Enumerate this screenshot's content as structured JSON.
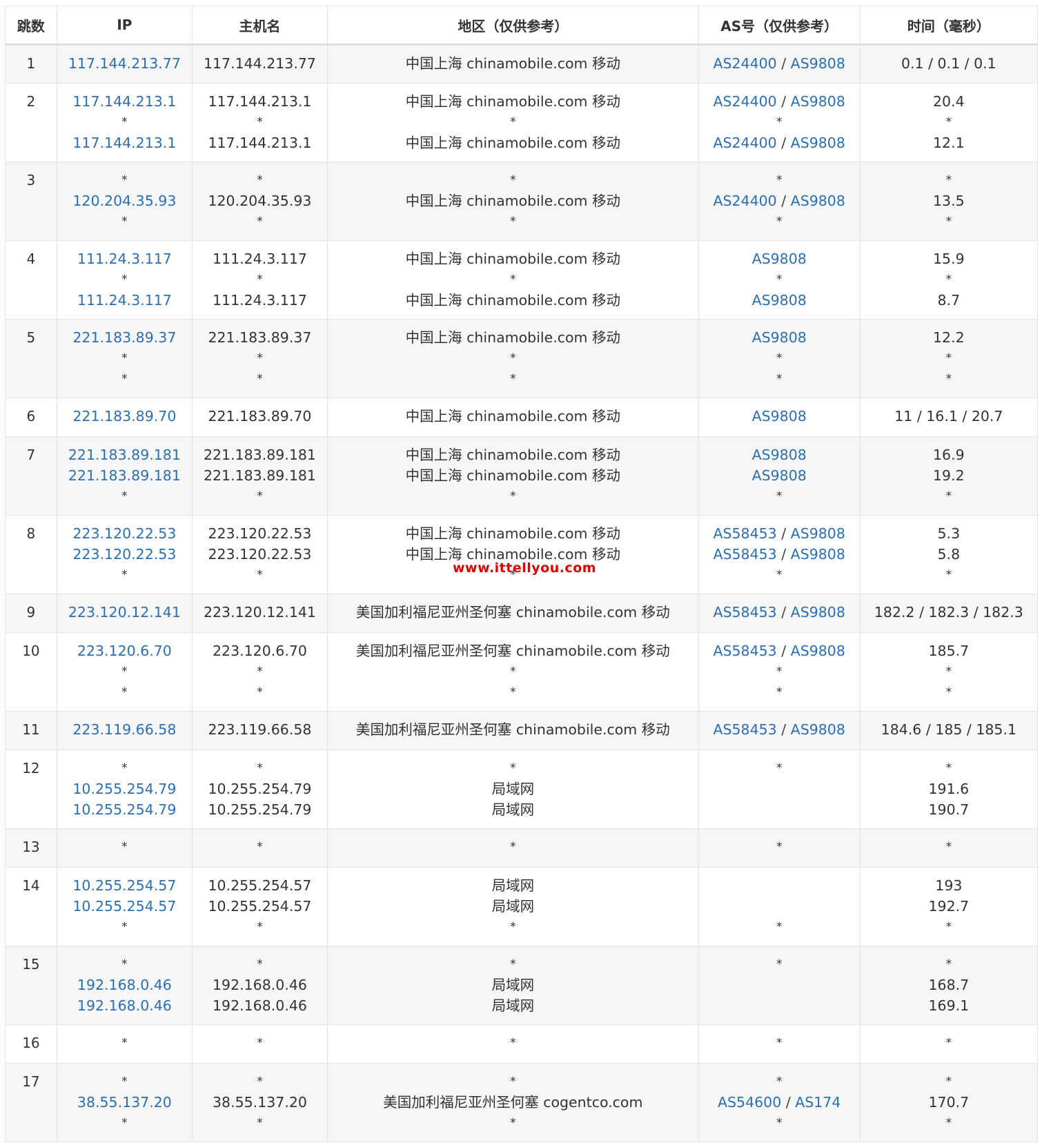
{
  "headers": [
    "跳数",
    "IP",
    "主机名",
    "地区（仅供参考）",
    "AS号（仅供参考）",
    "时间（毫秒）"
  ],
  "rows": [
    {
      "hop": "1",
      "lines": [
        {
          "ip": "117.144.213.77",
          "host": "117.144.213.77",
          "region": "中国上海 chinamobile.com 移动",
          "as": [
            "AS24400",
            "AS9808"
          ],
          "time": "0.1 / 0.1 / 0.1"
        }
      ]
    },
    {
      "hop": "2",
      "lines": [
        {
          "ip": "117.144.213.1",
          "host": "117.144.213.1",
          "region": "中国上海 chinamobile.com 移动",
          "as": [
            "AS24400",
            "AS9808"
          ],
          "time": "20.4"
        },
        {
          "ip": "*",
          "host": "*",
          "region": "*",
          "as": [
            "*"
          ],
          "time": "*"
        },
        {
          "ip": "117.144.213.1",
          "host": "117.144.213.1",
          "region": "中国上海 chinamobile.com 移动",
          "as": [
            "AS24400",
            "AS9808"
          ],
          "time": "12.1"
        }
      ]
    },
    {
      "hop": "3",
      "lines": [
        {
          "ip": "*",
          "host": "*",
          "region": "*",
          "as": [
            "*"
          ],
          "time": "*"
        },
        {
          "ip": "120.204.35.93",
          "host": "120.204.35.93",
          "region": "中国上海 chinamobile.com 移动",
          "as": [
            "AS24400",
            "AS9808"
          ],
          "time": "13.5"
        },
        {
          "ip": "*",
          "host": "*",
          "region": "*",
          "as": [
            "*"
          ],
          "time": "*"
        }
      ]
    },
    {
      "hop": "4",
      "lines": [
        {
          "ip": "111.24.3.117",
          "host": "111.24.3.117",
          "region": "中国上海 chinamobile.com 移动",
          "as": [
            "AS9808"
          ],
          "time": "15.9"
        },
        {
          "ip": "*",
          "host": "*",
          "region": "*",
          "as": [
            "*"
          ],
          "time": "*"
        },
        {
          "ip": "111.24.3.117",
          "host": "111.24.3.117",
          "region": "中国上海 chinamobile.com 移动",
          "as": [
            "AS9808"
          ],
          "time": "8.7"
        }
      ]
    },
    {
      "hop": "5",
      "lines": [
        {
          "ip": "221.183.89.37",
          "host": "221.183.89.37",
          "region": "中国上海 chinamobile.com 移动",
          "as": [
            "AS9808"
          ],
          "time": "12.2"
        },
        {
          "ip": "*",
          "host": "*",
          "region": "*",
          "as": [
            "*"
          ],
          "time": "*"
        },
        {
          "ip": "*",
          "host": "*",
          "region": "*",
          "as": [
            "*"
          ],
          "time": "*"
        }
      ]
    },
    {
      "hop": "6",
      "lines": [
        {
          "ip": "221.183.89.70",
          "host": "221.183.89.70",
          "region": "中国上海 chinamobile.com 移动",
          "as": [
            "AS9808"
          ],
          "time": "11 / 16.1 / 20.7"
        }
      ]
    },
    {
      "hop": "7",
      "lines": [
        {
          "ip": "221.183.89.181",
          "host": "221.183.89.181",
          "region": "中国上海 chinamobile.com 移动",
          "as": [
            "AS9808"
          ],
          "time": "16.9"
        },
        {
          "ip": "221.183.89.181",
          "host": "221.183.89.181",
          "region": "中国上海 chinamobile.com 移动",
          "as": [
            "AS9808"
          ],
          "time": "19.2"
        },
        {
          "ip": "*",
          "host": "*",
          "region": "*",
          "as": [
            "*"
          ],
          "time": "*"
        }
      ]
    },
    {
      "hop": "8",
      "lines": [
        {
          "ip": "223.120.22.53",
          "host": "223.120.22.53",
          "region": "中国上海 chinamobile.com 移动",
          "as": [
            "AS58453",
            "AS9808"
          ],
          "time": "5.3"
        },
        {
          "ip": "223.120.22.53",
          "host": "223.120.22.53",
          "region": "中国上海 chinamobile.com 移动",
          "as": [
            "AS58453",
            "AS9808"
          ],
          "time": "5.8"
        },
        {
          "ip": "*",
          "host": "*",
          "region": "*",
          "as": [
            "*"
          ],
          "time": "*"
        }
      ]
    },
    {
      "hop": "9",
      "lines": [
        {
          "ip": "223.120.12.141",
          "host": "223.120.12.141",
          "region": "美国加利福尼亚州圣何塞 chinamobile.com 移动",
          "as": [
            "AS58453",
            "AS9808"
          ],
          "time": "182.2 / 182.3 / 182.3"
        }
      ]
    },
    {
      "hop": "10",
      "lines": [
        {
          "ip": "223.120.6.70",
          "host": "223.120.6.70",
          "region": "美国加利福尼亚州圣何塞 chinamobile.com 移动",
          "as": [
            "AS58453",
            "AS9808"
          ],
          "time": "185.7"
        },
        {
          "ip": "*",
          "host": "*",
          "region": "*",
          "as": [
            "*"
          ],
          "time": "*"
        },
        {
          "ip": "*",
          "host": "*",
          "region": "*",
          "as": [
            "*"
          ],
          "time": "*"
        }
      ]
    },
    {
      "hop": "11",
      "lines": [
        {
          "ip": "223.119.66.58",
          "host": "223.119.66.58",
          "region": "美国加利福尼亚州圣何塞 chinamobile.com 移动",
          "as": [
            "AS58453",
            "AS9808"
          ],
          "time": "184.6 / 185 / 185.1"
        }
      ]
    },
    {
      "hop": "12",
      "lines": [
        {
          "ip": "*",
          "host": "*",
          "region": "*",
          "as": [
            "*"
          ],
          "time": "*"
        },
        {
          "ip": "10.255.254.79",
          "host": "10.255.254.79",
          "region": "局域网",
          "as": [],
          "time": "191.6"
        },
        {
          "ip": "10.255.254.79",
          "host": "10.255.254.79",
          "region": "局域网",
          "as": [],
          "time": "190.7"
        }
      ]
    },
    {
      "hop": "13",
      "lines": [
        {
          "ip": "*",
          "host": "*",
          "region": "*",
          "as": [
            "*"
          ],
          "time": "*"
        }
      ]
    },
    {
      "hop": "14",
      "lines": [
        {
          "ip": "10.255.254.57",
          "host": "10.255.254.57",
          "region": "局域网",
          "as": [],
          "time": "193"
        },
        {
          "ip": "10.255.254.57",
          "host": "10.255.254.57",
          "region": "局域网",
          "as": [],
          "time": "192.7"
        },
        {
          "ip": "*",
          "host": "*",
          "region": "*",
          "as": [
            "*"
          ],
          "time": "*"
        }
      ]
    },
    {
      "hop": "15",
      "lines": [
        {
          "ip": "*",
          "host": "*",
          "region": "*",
          "as": [
            "*"
          ],
          "time": "*"
        },
        {
          "ip": "192.168.0.46",
          "host": "192.168.0.46",
          "region": "局域网",
          "as": [],
          "time": "168.7"
        },
        {
          "ip": "192.168.0.46",
          "host": "192.168.0.46",
          "region": "局域网",
          "as": [],
          "time": "169.1"
        }
      ]
    },
    {
      "hop": "16",
      "lines": [
        {
          "ip": "*",
          "host": "*",
          "region": "*",
          "as": [
            "*"
          ],
          "time": "*"
        }
      ]
    },
    {
      "hop": "17",
      "lines": [
        {
          "ip": "*",
          "host": "*",
          "region": "*",
          "as": [
            "*"
          ],
          "time": "*"
        },
        {
          "ip": "38.55.137.20",
          "host": "38.55.137.20",
          "region": "美国加利福尼亚州圣何塞 cogentco.com",
          "as": [
            "AS54600",
            "AS174"
          ],
          "time": "170.7"
        },
        {
          "ip": "*",
          "host": "*",
          "region": "*",
          "as": [
            "*"
          ],
          "time": "*"
        }
      ]
    }
  ],
  "as_separator": " / ",
  "watermark": "www.ittellyou.com",
  "colors": {
    "link": "#2a6fb5",
    "text": "#333333",
    "stripe": "#f6f6f6",
    "border": "#e3e3e3",
    "watermark": "#e00000"
  }
}
